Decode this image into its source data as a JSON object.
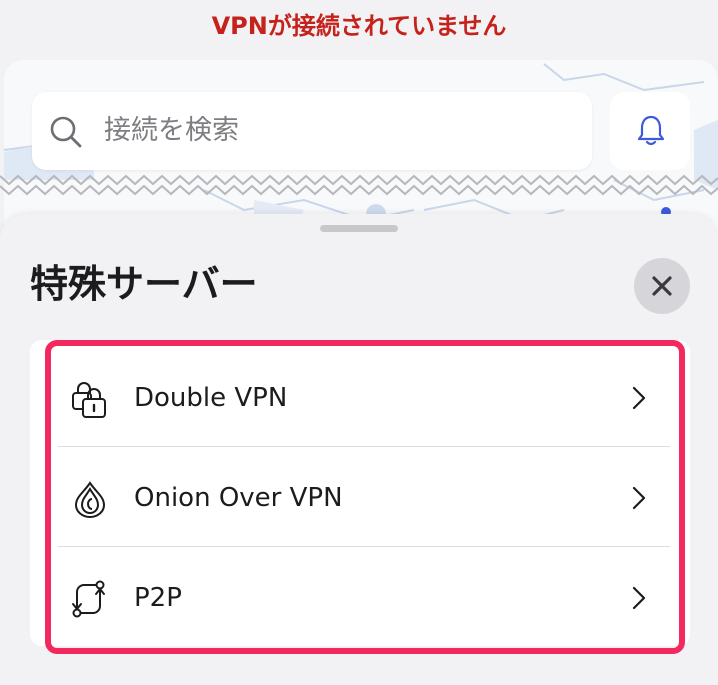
{
  "status": {
    "text": "VPNが接続されていません",
    "color": "#c4221b"
  },
  "search": {
    "placeholder": "接続を検索",
    "icon": "search-icon"
  },
  "notifications": {
    "icon": "bell-icon",
    "color": "#3b5bdb"
  },
  "sheet": {
    "title": "特殊サーバー",
    "close_icon": "close-icon",
    "highlight_color": "#f2285f",
    "items": [
      {
        "label": "Double VPN",
        "icon": "double-lock-icon"
      },
      {
        "label": "Onion Over VPN",
        "icon": "onion-icon"
      },
      {
        "label": "P2P",
        "icon": "p2p-arrows-icon"
      }
    ]
  }
}
